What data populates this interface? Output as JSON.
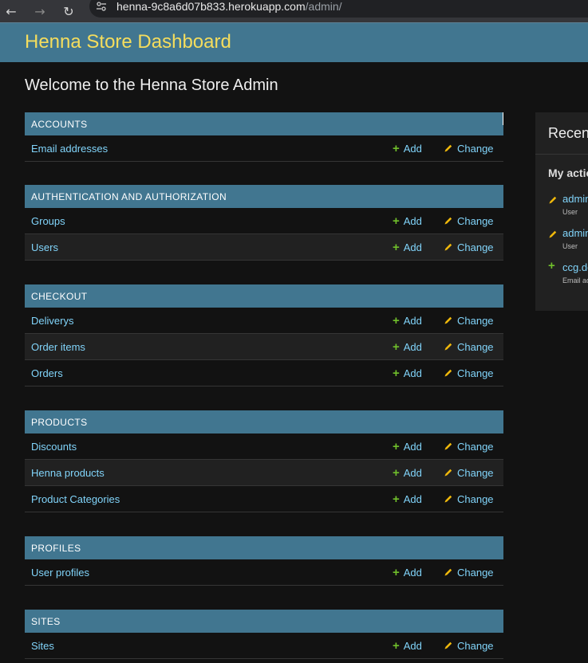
{
  "browser": {
    "url_host": "henna-9c8a6d07b833.herokuapp.com",
    "url_path": "/admin/"
  },
  "header": {
    "brand": "Henna Store Dashboard"
  },
  "page_title": "Welcome to the Henna Store Admin",
  "labels": {
    "add": "Add",
    "change": "Change"
  },
  "modules": [
    {
      "caption": "ACCOUNTS",
      "models": [
        "Email addresses"
      ]
    },
    {
      "caption": "AUTHENTICATION AND AUTHORIZATION",
      "models": [
        "Groups",
        "Users"
      ]
    },
    {
      "caption": "CHECKOUT",
      "models": [
        "Deliverys",
        "Order items",
        "Orders"
      ]
    },
    {
      "caption": "PRODUCTS",
      "models": [
        "Discounts",
        "Henna products",
        "Product Categories"
      ]
    },
    {
      "caption": "PROFILES",
      "models": [
        "User profiles"
      ]
    },
    {
      "caption": "SITES",
      "models": [
        "Sites"
      ]
    }
  ],
  "recent": {
    "title": "Recent actions",
    "my_actions": "My actions",
    "items": [
      {
        "icon": "pencil-icon",
        "link": "admin",
        "type": "User"
      },
      {
        "icon": "pencil-icon",
        "link": "admin",
        "type": "User"
      },
      {
        "icon": "plus-icon",
        "link": "ccg.dev",
        "type": "Email address"
      }
    ]
  },
  "colors": {
    "header_bg": "#417690",
    "brand": "#f5dd5d",
    "link": "#81d4fa",
    "add_icon": "#70bf2b",
    "change_icon": "#efb80b"
  }
}
